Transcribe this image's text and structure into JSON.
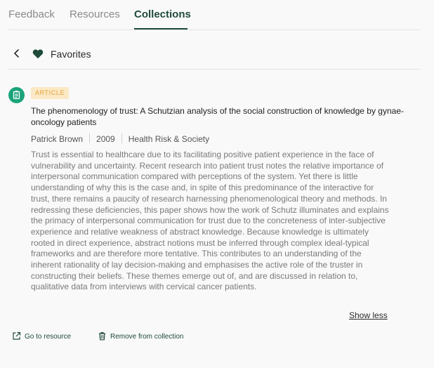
{
  "tabs": [
    {
      "label": "Feedback"
    },
    {
      "label": "Resources"
    },
    {
      "label": "Collections",
      "active": true
    }
  ],
  "collection": {
    "title": "Favorites",
    "icon": "heart-icon"
  },
  "item": {
    "badge": "ARTICLE",
    "title": "The phenomenology of trust: A Schutzian analysis of the social construction of knowledge by gynae-oncology patients",
    "author": "Patrick Brown",
    "year": "2009",
    "journal": "Health Risk & Society",
    "abstract": "Trust is essential to healthcare due to its facilitating positive patient experience in the face of vulnerability and uncertainty. Recent research into patient trust notes the relative importance of interpersonal communication compared with perceptions of the system. Yet there is little understanding of why this is the case and, in spite of this predominance of the interactive for trust, there remains a paucity of research harnessing phenomenological theory and methods. In redressing these deficiencies, this paper shows how the work of Schutz illuminates and explains the primacy of interpersonal communication for trust due to the concreteness of inter-subjective experience and relative weakness of abstract knowledge. Because knowledge is ultimately rooted in direct experience, abstract notions must be inferred through complex ideal-typical frameworks and are therefore more tentative. This contributes to an understanding of the inherent rationality of lay decision-making and emphasises the active role of the truster in constructing their beliefs. These themes emerge out of, and are discussed in relation to, qualitative data from interviews with cervical cancer patients.",
    "show_less": "Show less"
  },
  "actions": {
    "go_to_resource": "Go to resource",
    "remove_from_collection": "Remove from collection"
  },
  "colors": {
    "accent": "#1f4b3a",
    "icon_green": "#1aa37a",
    "badge_bg": "#fbe9c5",
    "badge_text": "#e2a13a"
  }
}
